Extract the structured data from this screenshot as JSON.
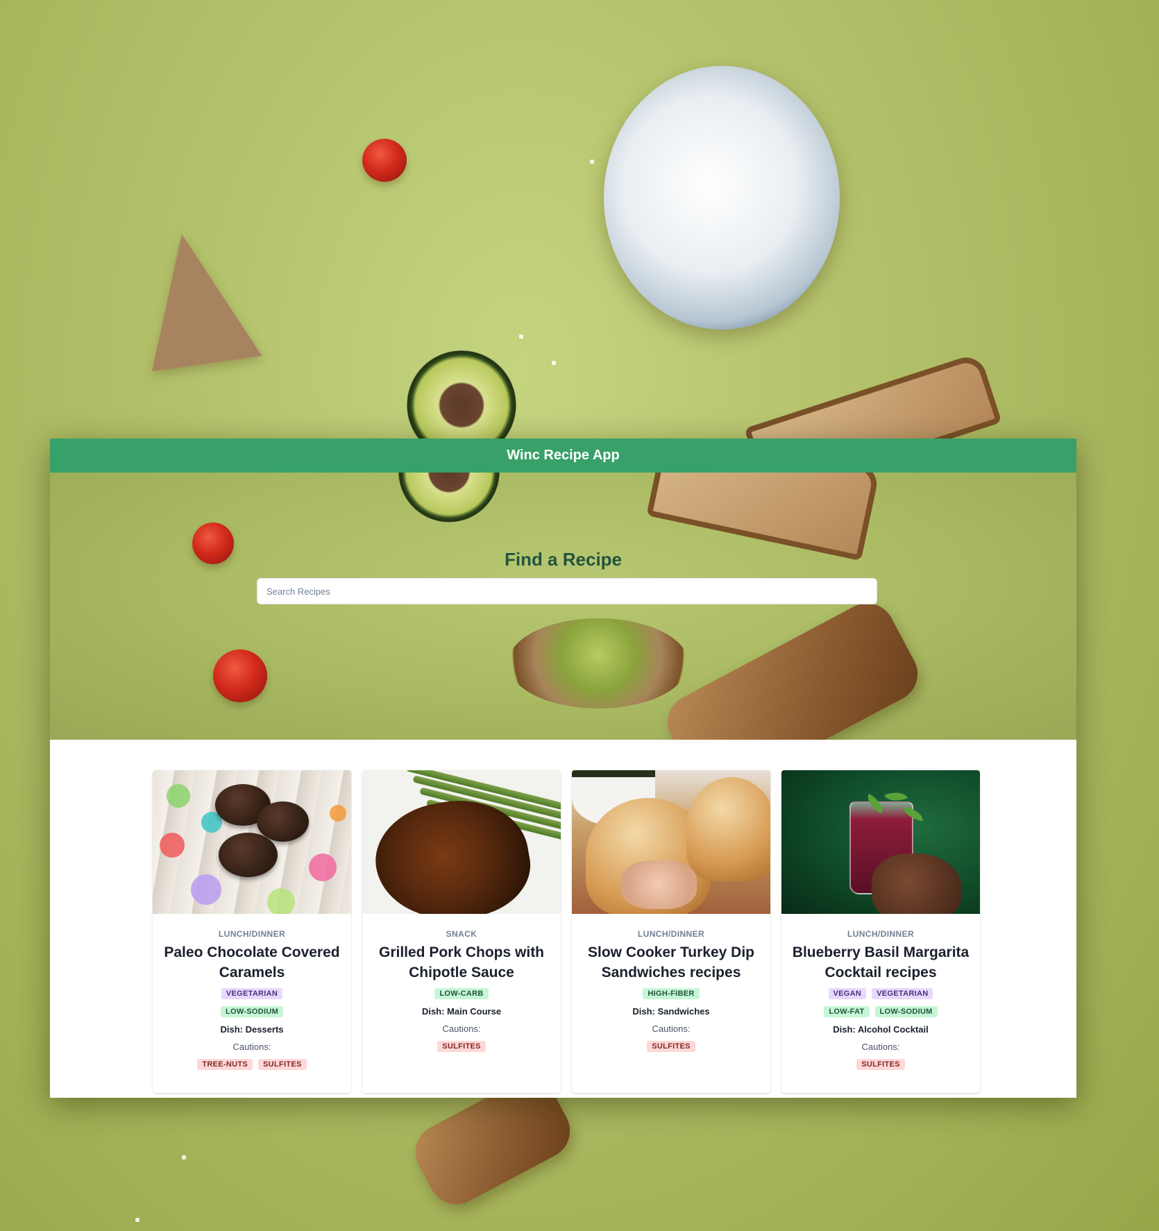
{
  "app": {
    "title": "Winc Recipe App"
  },
  "hero": {
    "heading": "Find a Recipe",
    "search_placeholder": "Search Recipes",
    "search_value": ""
  },
  "colors": {
    "header_green": "#38a169",
    "heading_dark_green": "#22543d",
    "diet_tag_bg": "#e9d8fd",
    "health_tag_bg": "#c6f6d5",
    "caution_tag_bg": "#fed7d7"
  },
  "recipes": [
    {
      "image_desc_icon": "chocolate-caramels-photo",
      "meal_type": "LUNCH/DINNER",
      "title": "Paleo Chocolate Covered Caramels",
      "diet_labels": [
        "VEGETARIAN"
      ],
      "health_labels": [
        "LOW-SODIUM"
      ],
      "dish": "Dish: Desserts",
      "cautions_label": "Cautions:",
      "cautions": [
        "TREE-NUTS",
        "SULFITES"
      ]
    },
    {
      "image_desc_icon": "grilled-pork-chop-photo",
      "meal_type": "SNACK",
      "title": "Grilled Pork Chops with Chipotle Sauce",
      "diet_labels": [],
      "health_labels": [
        "LOW-CARB"
      ],
      "dish": "Dish: Main Course",
      "cautions_label": "Cautions:",
      "cautions": [
        "SULFITES"
      ]
    },
    {
      "image_desc_icon": "turkey-sandwich-photo",
      "meal_type": "LUNCH/DINNER",
      "title": "Slow Cooker Turkey Dip Sandwiches recipes",
      "diet_labels": [],
      "health_labels": [
        "HIGH-FIBER"
      ],
      "dish": "Dish: Sandwiches",
      "cautions_label": "Cautions:",
      "cautions": [
        "SULFITES"
      ]
    },
    {
      "image_desc_icon": "blueberry-cocktail-photo",
      "meal_type": "LUNCH/DINNER",
      "title": "Blueberry Basil Margarita Cocktail recipes",
      "diet_labels": [
        "VEGAN",
        "VEGETARIAN"
      ],
      "health_labels": [
        "LOW-FAT",
        "LOW-SODIUM"
      ],
      "dish": "Dish: Alcohol Cocktail",
      "cautions_label": "Cautions:",
      "cautions": [
        "SULFITES"
      ]
    }
  ]
}
